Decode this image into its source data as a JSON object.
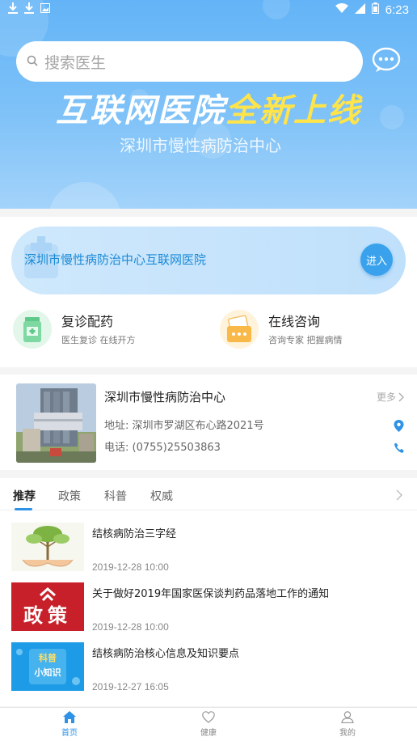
{
  "status_bar": {
    "time": "6:23",
    "left_icons": [
      "download-icon",
      "download-icon",
      "image-icon"
    ],
    "right_icons": [
      "wifi-icon",
      "signal-icon",
      "battery-icon"
    ]
  },
  "search": {
    "placeholder": "搜索医生"
  },
  "banner": {
    "title_part1": "互联网医院",
    "title_part2": "全新上线",
    "subtitle": "深圳市慢性病防治中心",
    "colors": {
      "gradient_top": "#63b4f7",
      "gradient_bottom": "#a3d3fa",
      "highlight": "#ffe44a"
    }
  },
  "hospital_strip": {
    "name": "深圳市慢性病防治中心互联网医院",
    "enter_label": "进入"
  },
  "features": [
    {
      "title": "复诊配药",
      "desc": "医生复诊 在线开方",
      "icon": "medicine-bottle-icon"
    },
    {
      "title": "在线咨询",
      "desc": "咨询专家 把握病情",
      "icon": "consult-card-icon"
    }
  ],
  "center": {
    "name": "深圳市慢性病防治中心",
    "more_label": "更多",
    "address": "地址: 深圳市罗湖区布心路2021号",
    "phone": "电话: (0755)25503863"
  },
  "news": {
    "tabs": [
      "推荐",
      "政策",
      "科普",
      "权威"
    ],
    "active_tab": 0,
    "items": [
      {
        "title": "结核病防治三字经",
        "date": "2019-12-28 10:00",
        "thumb": "tree-hands"
      },
      {
        "title": "关于做好2019年国家医保谈判药品落地工作的通知",
        "date": "2019-12-28 10:00",
        "thumb": "policy",
        "thumb_text": "政策"
      },
      {
        "title": "结核病防治核心信息及知识要点",
        "date": "2019-12-27 16:05",
        "thumb": "science",
        "thumb_line1": "科普",
        "thumb_line2": "小知识"
      }
    ]
  },
  "bottom_nav": [
    {
      "label": "首页",
      "icon": "home-icon",
      "active": true
    },
    {
      "label": "健康",
      "icon": "heart-icon",
      "active": false
    },
    {
      "label": "我的",
      "icon": "user-icon",
      "active": false
    }
  ],
  "accent_color": "#2e92e6"
}
